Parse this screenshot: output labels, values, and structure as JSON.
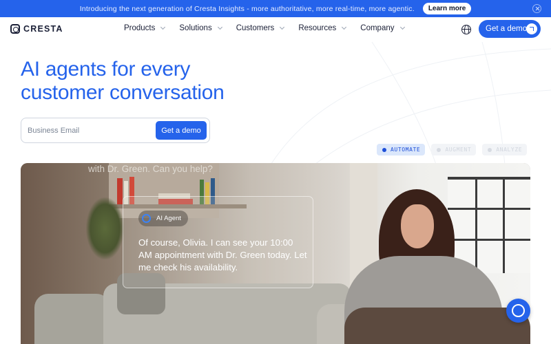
{
  "banner": {
    "text": "Introducing the next generation of Cresta Insights - more authoritative, more real-time, more agentic.",
    "button_label": "Learn more"
  },
  "nav": {
    "logo_text": "CRESTA",
    "items": [
      {
        "label": "Products"
      },
      {
        "label": "Solutions"
      },
      {
        "label": "Customers"
      },
      {
        "label": "Resources"
      },
      {
        "label": "Company"
      }
    ],
    "cta_label": "Get a demo"
  },
  "hero": {
    "title_line1": "AI agents for every",
    "title_line2": "customer conversation",
    "email_placeholder": "Business Email",
    "submit_label": "Get a demo"
  },
  "modes": [
    {
      "label": "AUTOMATE",
      "active": true
    },
    {
      "label": "AUGMENT",
      "active": false
    },
    {
      "label": "ANALYZE",
      "active": false
    }
  ],
  "video": {
    "ghost_text": "with Dr. Green. Can you help?",
    "agent_label": "AI Agent",
    "message": "Of course, Olivia. I can see your 10:00 AM appointment with Dr. Green today. Let me check his availability."
  },
  "colors": {
    "brand": "#2563eb",
    "text_dark": "#1a1f36"
  },
  "icons": {
    "globe": "globe-icon",
    "close": "close-icon",
    "arrow": "arrow-up-right-icon",
    "chat": "chat-launcher-icon"
  }
}
